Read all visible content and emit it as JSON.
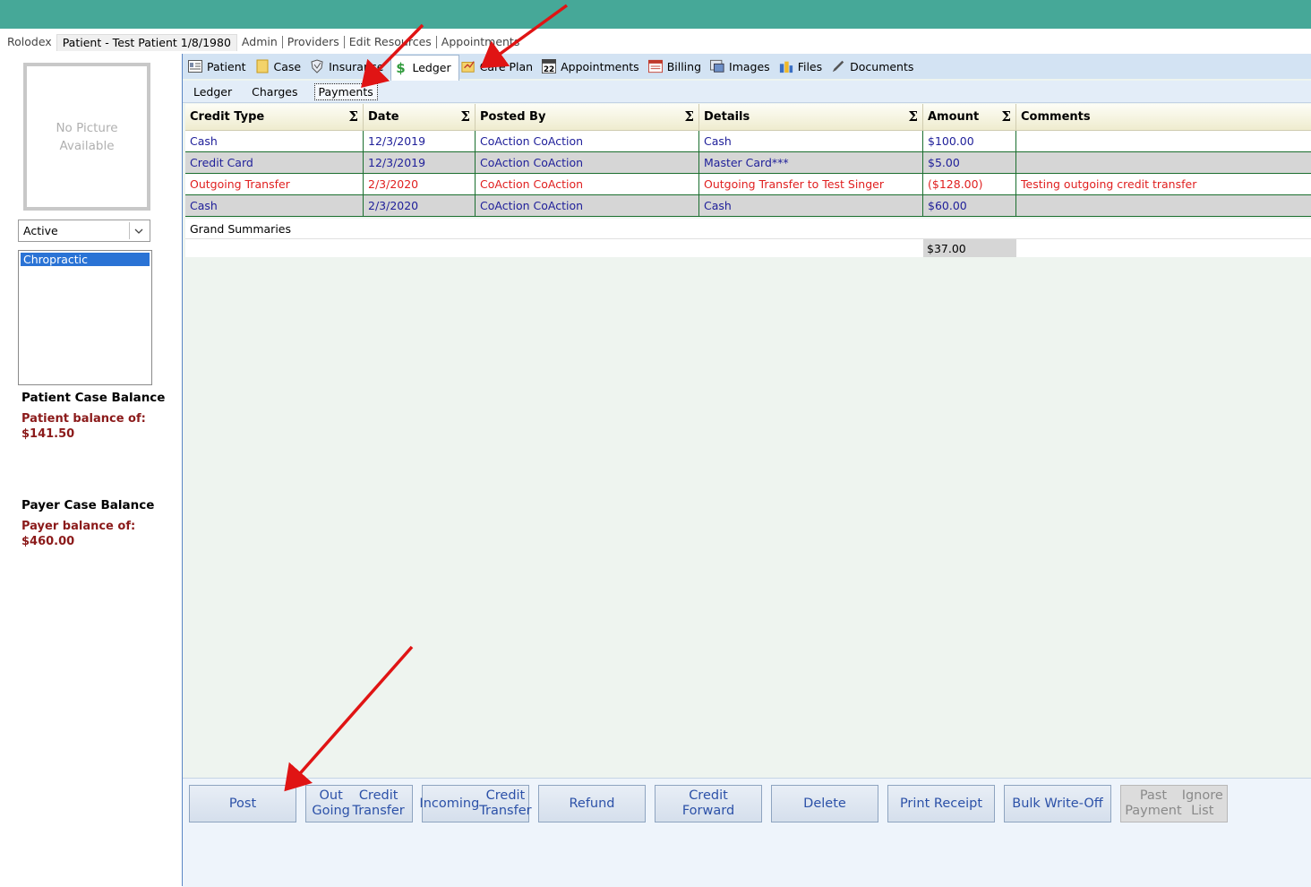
{
  "menu": {
    "items": [
      "Rolodex",
      "Patient - Test Patient 1/8/1980",
      "Admin",
      "Providers",
      "Edit Resources",
      "Appointments"
    ]
  },
  "left": {
    "photo_text_line1": "No Picture",
    "photo_text_line2": "Available",
    "status_value": "Active",
    "case_item": "Chropractic",
    "patient_balance_title": "Patient Case Balance",
    "patient_balance_label": "Patient balance of:",
    "patient_balance_value": "$141.50",
    "payer_balance_title": "Payer Case Balance",
    "payer_balance_label": "Payer balance of:",
    "payer_balance_value": "$460.00"
  },
  "tabs": [
    {
      "label": "Patient",
      "icon": "id-card-icon"
    },
    {
      "label": "Case",
      "icon": "folder-icon"
    },
    {
      "label": "Insurance",
      "icon": "shield-icon"
    },
    {
      "label": "Ledger",
      "icon": "dollar-icon"
    },
    {
      "label": "Care Plan",
      "icon": "care-plan-icon"
    },
    {
      "label": "Appointments",
      "icon": "calendar-icon"
    },
    {
      "label": "Billing",
      "icon": "billing-icon"
    },
    {
      "label": "Images",
      "icon": "images-icon"
    },
    {
      "label": "Files",
      "icon": "files-icon"
    },
    {
      "label": "Documents",
      "icon": "pen-icon"
    }
  ],
  "subtabs": [
    "Ledger",
    "Charges",
    "Payments"
  ],
  "grid": {
    "columns": [
      "Credit Type",
      "Date",
      "Posted By",
      "Details",
      "Amount",
      "Comments"
    ],
    "sigma": "Σ",
    "rows": [
      [
        "Cash",
        "12/3/2019",
        "CoAction CoAction",
        "Cash",
        "$100.00",
        ""
      ],
      [
        "Credit Card",
        "12/3/2019",
        "CoAction CoAction",
        "Master Card***",
        "$5.00",
        ""
      ],
      [
        "Outgoing Transfer",
        "2/3/2020",
        "CoAction CoAction",
        "Outgoing Transfer to Test Singer",
        "($128.00)",
        "Testing outgoing credit transfer"
      ],
      [
        "Cash",
        "2/3/2020",
        "CoAction CoAction",
        "Cash",
        "$60.00",
        ""
      ]
    ],
    "grand_summaries_label": "Grand Summaries",
    "grand_total": "$37.00"
  },
  "buttons": {
    "post": "Post",
    "out_transfer_1": "Out Going",
    "out_transfer_2": "Credit Transfer",
    "in_transfer_1": "Incoming",
    "in_transfer_2": "Credit Transfer",
    "refund": "Refund",
    "credit_forward": "Credit Forward",
    "delete": "Delete",
    "print_receipt": "Print Receipt",
    "bulk_writeoff": "Bulk Write-Off",
    "ignore_1": "Past Payment",
    "ignore_2": "Ignore List"
  },
  "colors": {
    "header_teal": "#46a898",
    "annotation_arrow": "#e01414",
    "row_text_blue": "#20209a",
    "row_text_red": "#e02020"
  }
}
